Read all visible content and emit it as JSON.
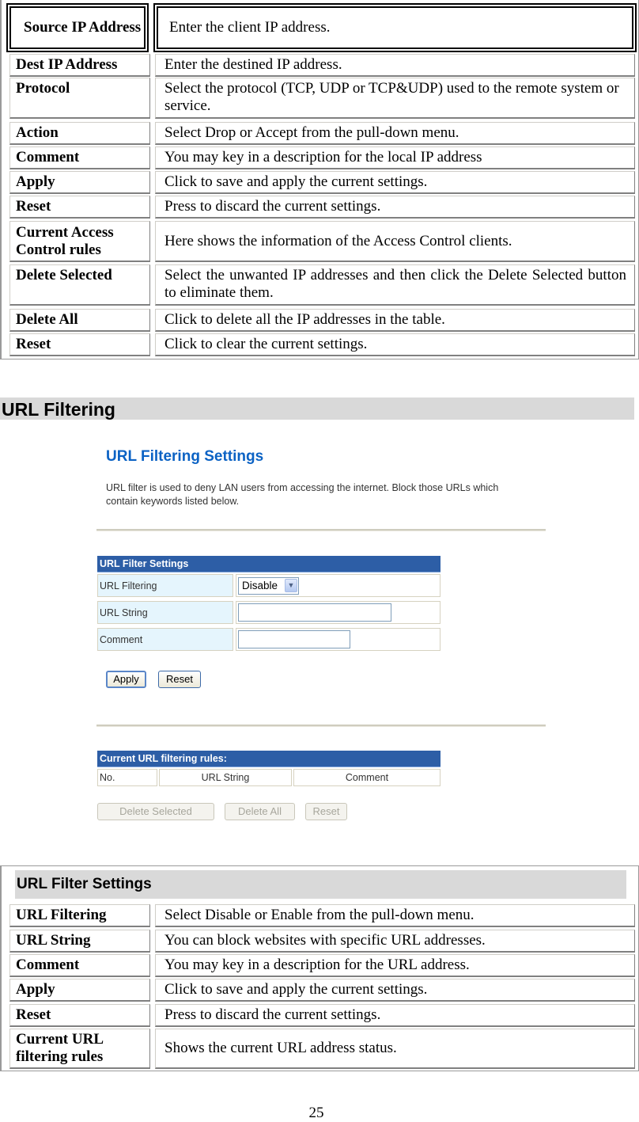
{
  "access_control_table": {
    "rows": [
      {
        "key": "Source IP Address",
        "value": "Enter the client IP address."
      },
      {
        "key": "Dest IP Address",
        "value": "Enter the destined IP address."
      },
      {
        "key": "Protocol",
        "value": "Select the protocol (TCP, UDP or TCP&UDP) used to the remote system or service."
      },
      {
        "key": "Action",
        "value": "Select Drop or Accept from the pull-down menu."
      },
      {
        "key": "Comment",
        "value": "You may key in a description for the local IP address"
      },
      {
        "key": "Apply",
        "value": "Click to save and apply the current settings."
      },
      {
        "key": "Reset",
        "value": "Press to discard the current settings."
      },
      {
        "key": "Current Access Control rules",
        "value": "Here shows the information of the Access Control clients."
      },
      {
        "key": "Delete Selected",
        "value": "Select the unwanted IP addresses and then click the Delete Selected button to eliminate them."
      },
      {
        "key": "Delete All",
        "value": "Click to delete all the IP addresses in the table."
      },
      {
        "key": "Reset",
        "value": "Click to clear the current settings."
      }
    ]
  },
  "section_heading": "URL Filtering",
  "screenshot": {
    "title": "URL Filtering Settings",
    "description": "URL filter is used to deny LAN users from accessing the internet. Block those URLs which contain keywords listed below.",
    "settings_table": {
      "header": "URL Filter Settings",
      "rows": [
        {
          "label": "URL Filtering",
          "type": "select",
          "value": "Disable"
        },
        {
          "label": "URL String",
          "type": "text",
          "value": ""
        },
        {
          "label": "Comment",
          "type": "text",
          "value": ""
        }
      ]
    },
    "buttons": {
      "apply": "Apply",
      "reset": "Reset"
    },
    "rules_table": {
      "header": "Current URL filtering rules:",
      "columns": [
        "No.",
        "URL String",
        "Comment"
      ]
    },
    "rules_buttons": {
      "delete_selected": "Delete Selected",
      "delete_all": "Delete All",
      "reset": "Reset"
    },
    "colors": {
      "title": "#0b62c4",
      "table_header": "#2d5ea6",
      "label_bg": "#e5f5fd"
    }
  },
  "url_filter_table": {
    "header": "URL Filter Settings",
    "rows": [
      {
        "key": "URL Filtering",
        "value": "Select Disable or Enable from the pull-down menu."
      },
      {
        "key": "URL String",
        "value": "You can block websites with specific URL addresses."
      },
      {
        "key": "Comment",
        "value": "You may key in a description for the URL address."
      },
      {
        "key": "Apply",
        "value": "Click to save and apply the current settings."
      },
      {
        "key": "Reset",
        "value": "Press to discard the current settings."
      },
      {
        "key": "Current URL filtering rules",
        "value": "Shows the current URL address status."
      }
    ]
  },
  "page_number": "25"
}
